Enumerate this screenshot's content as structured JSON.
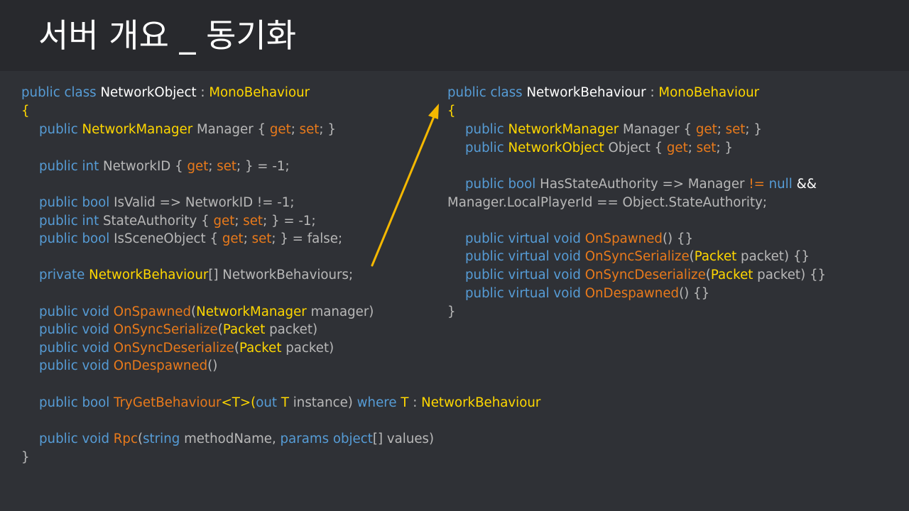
{
  "title": "서버 개요 _ 동기화",
  "left": {
    "l1": {
      "a": "public class ",
      "b": "NetworkObject",
      "c": " : ",
      "d": "MonoBehaviour"
    },
    "l2": "{",
    "l3": {
      "a": "public ",
      "b": "NetworkManager",
      "c": " Manager { ",
      "d": "get",
      "e": "; ",
      "f": "set",
      "g": "; }"
    },
    "l4": {
      "a": "public int ",
      "b": "NetworkID { ",
      "c": "get",
      "d": "; ",
      "e": "set",
      "f": "; } = -1;"
    },
    "l5": {
      "a": "public bool ",
      "b": "IsValid => NetworkID != -1;"
    },
    "l6": {
      "a": "public int ",
      "b": "StateAuthority { ",
      "c": "get",
      "d": "; ",
      "e": "set",
      "f": "; } = -1;"
    },
    "l7": {
      "a": "public bool ",
      "b": "IsSceneObject { ",
      "c": "get",
      "d": "; ",
      "e": "set",
      "f": "; } = false;"
    },
    "l8": {
      "a": "private ",
      "b": "NetworkBehaviour",
      "c": "[] NetworkBehaviours;"
    },
    "l9": {
      "a": "public void ",
      "b": "OnSpawned",
      "c": "(",
      "d": "NetworkManager",
      "e": " manager)"
    },
    "l10": {
      "a": "public void ",
      "b": "OnSyncSerialize",
      "c": "(",
      "d": "Packet",
      "e": " packet)"
    },
    "l11": {
      "a": "public void ",
      "b": "OnSyncDeserialize",
      "c": "(",
      "d": "Packet",
      "e": " packet)"
    },
    "l12": {
      "a": "public void ",
      "b": "OnDespawned",
      "c": "()"
    },
    "l13": {
      "a": "public bool ",
      "b": "TryGetBehaviour",
      "c": "<",
      "d": "T",
      "e": ">(",
      "f": "out ",
      "g": "T",
      "h": " instance) ",
      "i": "where ",
      "j": "T",
      "k": " : ",
      "l": "NetworkBehaviour"
    },
    "l14": {
      "a": "public void ",
      "b": "Rpc",
      "c": "(",
      "d": "string",
      "e": " methodName, ",
      "f": "params object",
      "g": "[] values)"
    },
    "l15": "}"
  },
  "right": {
    "l1": {
      "a": "public class ",
      "b": "NetworkBehaviour",
      "c": " : ",
      "d": "MonoBehaviour"
    },
    "l2": "{",
    "l3": {
      "a": "public ",
      "b": "NetworkManager",
      "c": " Manager { ",
      "d": "get",
      "e": "; ",
      "f": "set",
      "g": "; }"
    },
    "l4": {
      "a": "public ",
      "b": "NetworkObject",
      "c": " Object { ",
      "d": "get",
      "e": "; ",
      "f": "set",
      "g": "; }"
    },
    "l5": {
      "a": "public bool ",
      "b": "HasStateAuthority => Manager ",
      "c": "!=",
      "d": " null",
      "e": " &&"
    },
    "l6": "Manager.LocalPlayerId == Object.StateAuthority;",
    "l7": {
      "a": "public virtual void ",
      "b": "OnSpawned",
      "c": "() {}"
    },
    "l8": {
      "a": "public virtual void ",
      "b": "OnSyncSerialize",
      "c": "(",
      "d": "Packet",
      "e": " packet) {}"
    },
    "l9": {
      "a": "public virtual void ",
      "b": "OnSyncDeserialize",
      "c": "(",
      "d": "Packet",
      "e": " packet) {}"
    },
    "l10": {
      "a": "public virtual void ",
      "b": "OnDespawned",
      "c": "() {}"
    },
    "l11": "}"
  },
  "colors": {
    "background": "#2f3136",
    "title_bar": "#28292d",
    "keyword": "#569cd6",
    "type": "#ffd700",
    "method": "#e97a1b",
    "arrow": "#f5b800"
  }
}
